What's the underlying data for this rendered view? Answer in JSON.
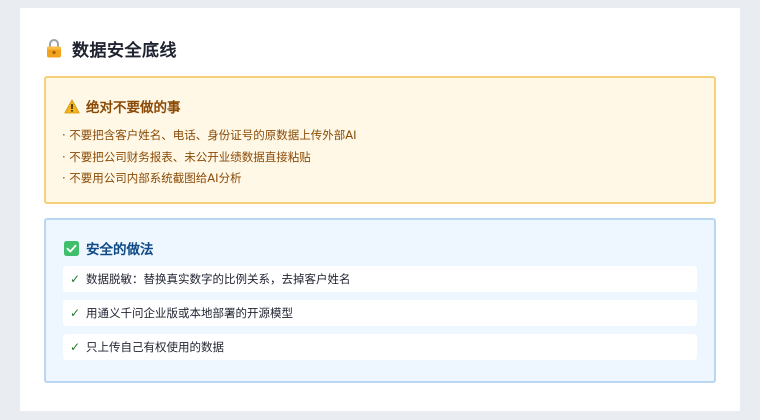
{
  "header": {
    "icon": "lock-icon",
    "title": "数据安全底线"
  },
  "warning": {
    "icon": "warning-icon",
    "title": "绝对不要做的事",
    "items": [
      "· 不要把含客户姓名、电话、身份证号的原数据上传外部AI",
      "· 不要把公司财务报表、未公开业绩数据直接粘贴",
      "· 不要用公司内部系统截图给AI分析"
    ],
    "colors": {
      "background": "#fff8e6",
      "border": "#f5cf7a",
      "text": "#8a4a06"
    }
  },
  "safe": {
    "icon": "check-box-icon",
    "title": "安全的做法",
    "items": [
      {
        "mark": "✓",
        "text": "数据脱敏：替换真实数字的比例关系，去掉客户姓名"
      },
      {
        "mark": "✓",
        "text": "用通义千问企业版或本地部署的开源模型"
      },
      {
        "mark": "✓",
        "text": "只上传自己有权使用的数据"
      }
    ],
    "colors": {
      "background": "#eef6ff",
      "border": "#b9d7f2",
      "title": "#0f4a86",
      "check": "#1f7a2e"
    }
  }
}
